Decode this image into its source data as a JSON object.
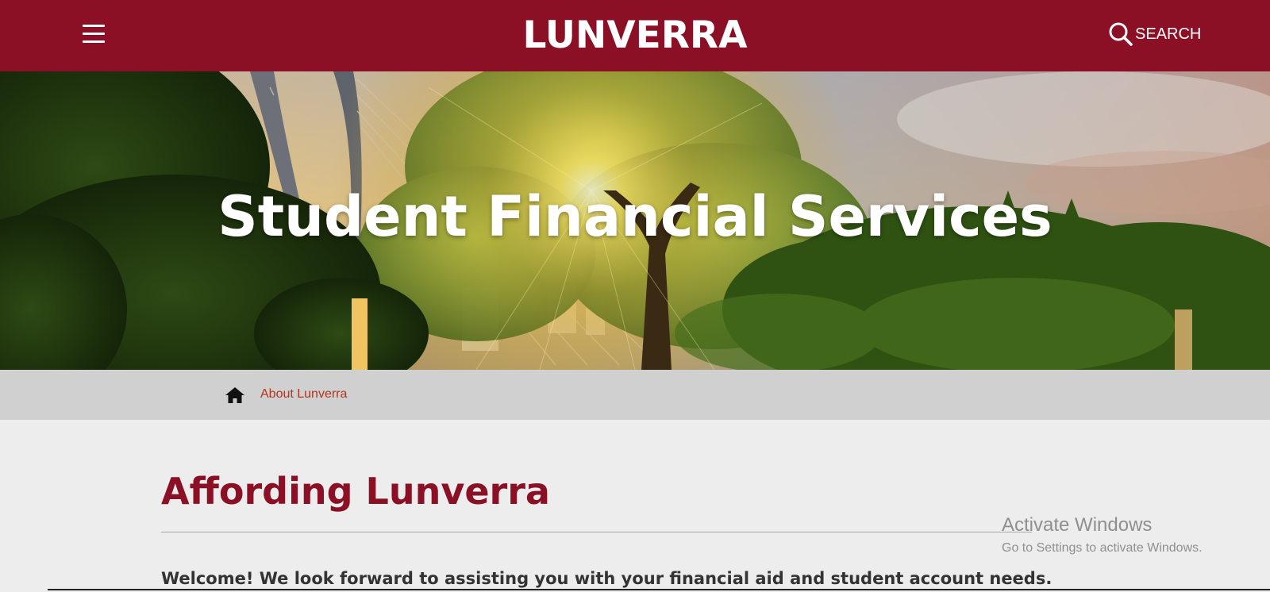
{
  "header": {
    "menu_icon": "hamburger-menu-icon",
    "brand": "LUNVERRA",
    "search_icon": "search-icon",
    "search_label": "SEARCH",
    "background_color": "#8b1025"
  },
  "hero": {
    "title": "Student Financial Services"
  },
  "breadcrumb": {
    "home_icon": "home-icon",
    "link": "About Lunverra",
    "link_color": "#b4331f"
  },
  "main": {
    "heading": "Affording Lunverra",
    "intro": "Welcome! We look forward to assisting you with your financial aid and student account needs."
  },
  "overlay": {
    "title": "Activate Windows",
    "subtitle": "Go to Settings to activate Windows."
  }
}
